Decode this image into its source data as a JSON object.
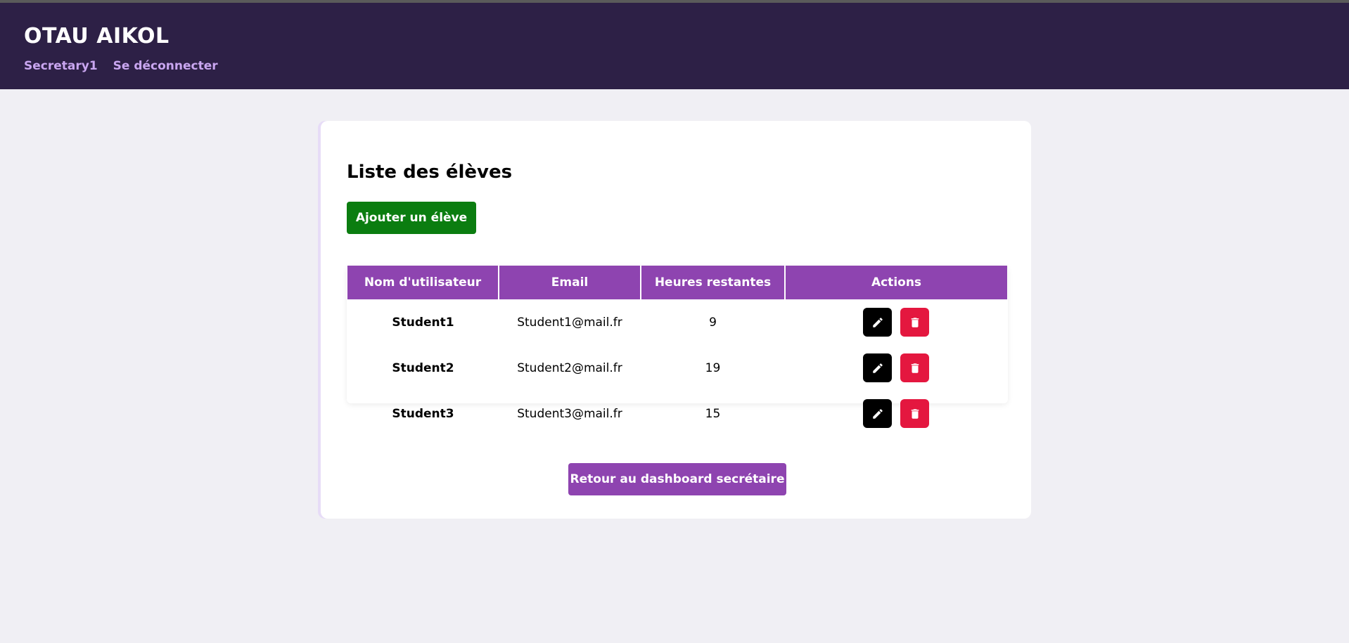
{
  "header": {
    "brand": "OTAU AIKOL",
    "nav": {
      "user_link": "Secretary1",
      "logout_link": "Se déconnecter"
    }
  },
  "main": {
    "title": "Liste des élèves",
    "add_button": "Ajouter un élève",
    "table": {
      "columns": [
        "Nom d'utilisateur",
        "Email",
        "Heures restantes",
        "Actions"
      ],
      "rows": [
        {
          "username": "Student1",
          "email": "Student1@mail.fr",
          "hours": "9"
        },
        {
          "username": "Student2",
          "email": "Student2@mail.fr",
          "hours": "19"
        },
        {
          "username": "Student3",
          "email": "Student3@mail.fr",
          "hours": "15"
        }
      ]
    },
    "back_button": "Retour au dashboard secrétaire"
  },
  "icons": {
    "edit": "pencil-icon",
    "delete": "trash-icon"
  },
  "colors": {
    "header_bg": "#2d2046",
    "nav_link": "#c9a6f0",
    "accent_purple": "#8e44b0",
    "add_green": "#0b7d10",
    "delete_red": "#e4173f",
    "edit_black": "#000000",
    "page_bg": "#f0eff4"
  }
}
